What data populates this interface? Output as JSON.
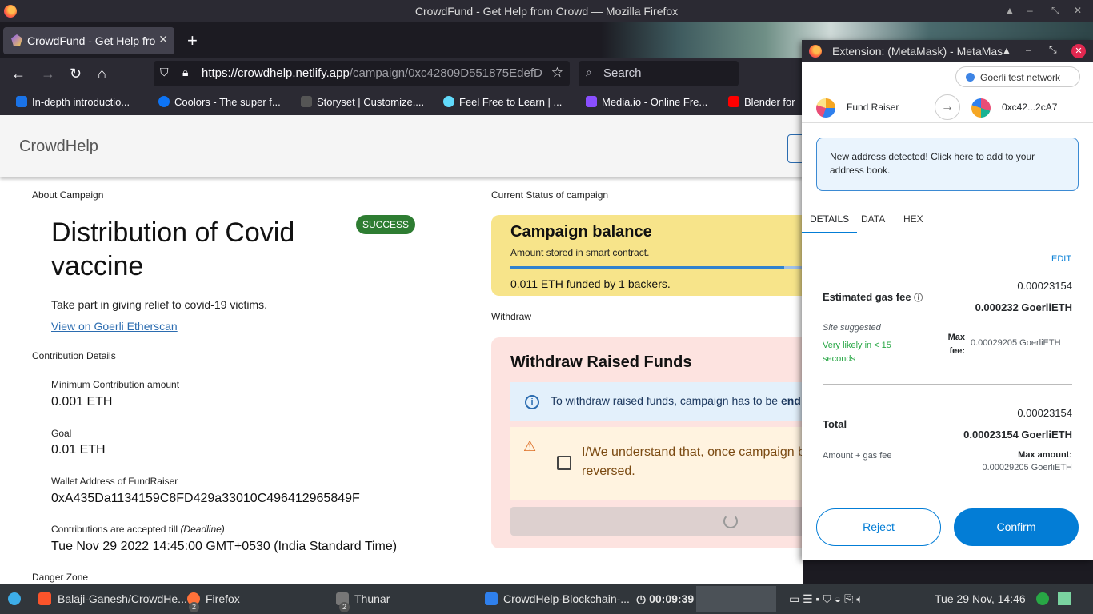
{
  "window": {
    "title": "CrowdFund - Get Help from Crowd — Mozilla Firefox"
  },
  "tabs": [
    {
      "label": "CrowdFund - Get Help from Crowd"
    }
  ],
  "nav": {
    "url_host": "https://crowdhelp.netlify.app",
    "url_path": "/campaign/0xc42809D551875EdefD",
    "search_placeholder": "Search"
  },
  "bookmarks": [
    {
      "label": "In-depth introductio...",
      "color": "#1a73e8"
    },
    {
      "label": "Coolors - The super f...",
      "color": "#0d74f5"
    },
    {
      "label": "Storyset | Customize,...",
      "color": "#2b2a33"
    },
    {
      "label": "Feel Free to Learn | ...",
      "color": "#61dafb"
    },
    {
      "label": "Media.io - Online Fre...",
      "color": "#8a4fff"
    },
    {
      "label": "Blender for",
      "color": "#ff0000"
    }
  ],
  "app": {
    "brand": "CrowdHelp",
    "about_label": "About Campaign",
    "title": "Distribution of Covid vaccine",
    "status": "SUCCESS",
    "description": "Take part in giving relief to covid-19 victims.",
    "etherscan_link": "View on Goerli Etherscan",
    "contrib_label": "Contribution Details",
    "min_label": "Minimum Contribution amount",
    "min_value": "0.001 ETH",
    "goal_label": "Goal",
    "goal_value": "0.01 ETH",
    "wallet_label": "Wallet Address of FundRaiser",
    "wallet_value": "0xA435Da1134159C8FD429a33010C496412965849F",
    "deadline_label": "Contributions are accepted till",
    "deadline_hint": "(Deadline)",
    "deadline_value": "Tue Nov 29 2022 14:45:00 GMT+0530 (India Standard Time)",
    "danger_label": "Danger Zone",
    "status_label": "Current Status of campaign",
    "balance_title": "Campaign balance",
    "balance_sub": "Amount stored in smart contract.",
    "balance_progress": 0.9,
    "balance_funded": "0.011 ETH funded by 1 backers.",
    "withdraw_label": "Withdraw",
    "withdraw_title": "Withdraw Raised Funds",
    "withdraw_info": "To withdraw raised funds, campaign has to be",
    "withdraw_info_bold": "end",
    "withdraw_warning": "I/We understand that, once campaign be reversed."
  },
  "metamask": {
    "title": "Extension: (MetaMask) - MetaMas",
    "network": "Goerli test network",
    "from": "Fund Raiser",
    "to": "0xc42...2cA7",
    "notice": "New address detected! Click here to add to your address book.",
    "tabs": [
      "DETAILS",
      "DATA",
      "HEX"
    ],
    "edit": "EDIT",
    "gas_small": "0.00023154",
    "gas_label": "Estimated gas fee",
    "gas_value": "0.000232 GoerliETH",
    "site_suggested": "Site suggested",
    "likely": "Very likely in < 15 seconds",
    "max_fee_label": "Max fee:",
    "max_fee_value": "0.00029205 GoerliETH",
    "total_small": "0.00023154",
    "total_label": "Total",
    "total_value": "0.00023154 GoerliETH",
    "amount_gas": "Amount + gas fee",
    "max_amount_label": "Max amount:",
    "max_amount_value": "0.00029205 GoerliETH",
    "reject": "Reject",
    "confirm": "Confirm",
    "accent": "#037dd6"
  },
  "taskbar": {
    "items": [
      {
        "label": "Balaji-Ganesh/CrowdHe..."
      },
      {
        "label": "Firefox",
        "count": "2"
      },
      {
        "label": "Thunar",
        "count": "2"
      },
      {
        "label": "CrowdHelp-Blockchain-..."
      }
    ],
    "timer": "00:09:39",
    "clock": "Tue 29 Nov, 14:46"
  }
}
